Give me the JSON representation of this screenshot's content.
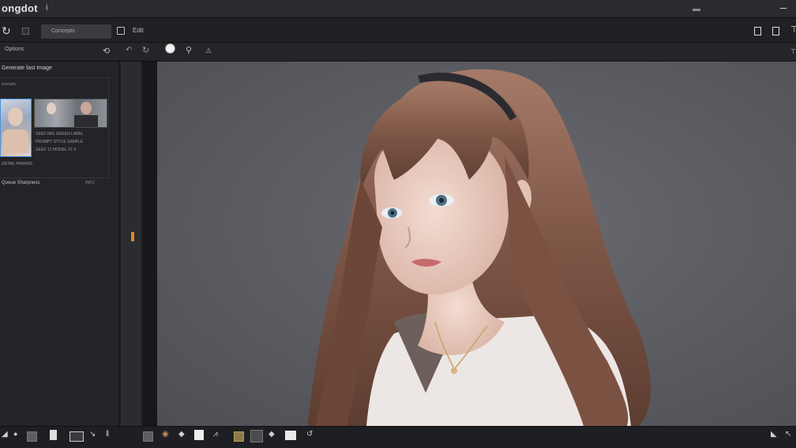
{
  "app": {
    "title": "ongdot",
    "separator": "i",
    "dots": "▬",
    "minimize": "–"
  },
  "toolbar": {
    "project_field": "Concepts",
    "label": "Edit"
  },
  "subbar": {
    "panel_tab": "Options"
  },
  "left_panel": {
    "heading": "Generate fast Image",
    "sub": "prompts",
    "thumb_meta": [
      "SEED IMG GREEN  LABEL",
      "PROMPT  STYLE  SAMPLE",
      "SEED 12 MODEL V1.5",
      "DETAIL PARAMS"
    ],
    "footer_left": "Queue Sharpness",
    "footer_right": "INFO"
  },
  "icons": {
    "back": "back-arrow-icon",
    "grid": "grid-icon",
    "save": "save-icon",
    "window_a": "window-icon",
    "window_b": "window-icon"
  },
  "colors": {
    "accent_handle": "#e08a24",
    "selection": "#4b8fd8",
    "canvas_bg": "#5a5b61"
  }
}
